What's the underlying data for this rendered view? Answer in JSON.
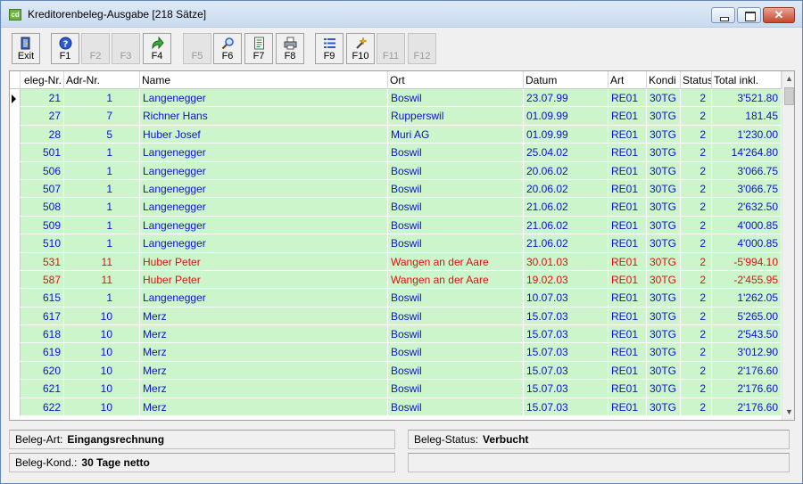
{
  "window": {
    "icon_text": "cd",
    "title": "Kreditorenbeleg-Ausgabe [218 Sätze]"
  },
  "toolbar": [
    {
      "label": "Exit",
      "icon": "exit-door-icon",
      "enabled": true
    },
    {
      "label": "F1",
      "icon": "help-icon",
      "enabled": true
    },
    {
      "label": "F2",
      "icon": "",
      "enabled": false
    },
    {
      "label": "F3",
      "icon": "",
      "enabled": false
    },
    {
      "label": "F4",
      "icon": "back-arrow-icon",
      "enabled": true
    },
    {
      "label": "F5",
      "icon": "",
      "enabled": false
    },
    {
      "label": "F6",
      "icon": "search-icon",
      "enabled": true
    },
    {
      "label": "F7",
      "icon": "document-icon",
      "enabled": true
    },
    {
      "label": "F8",
      "icon": "printer-icon",
      "enabled": true
    },
    {
      "label": "F9",
      "icon": "list-icon",
      "enabled": true
    },
    {
      "label": "F10",
      "icon": "wand-icon",
      "enabled": true
    },
    {
      "label": "F11",
      "icon": "",
      "enabled": false
    },
    {
      "label": "F12",
      "icon": "",
      "enabled": false
    }
  ],
  "table": {
    "columns": [
      "eleg-Nr.",
      "Adr-Nr.",
      "Name",
      "Ort",
      "Datum",
      "Art",
      "Kondi",
      "Status",
      "Total inkl."
    ],
    "rows": [
      {
        "beleg": "21",
        "adr": "1",
        "name": "Langenegger",
        "ort": "Boswil",
        "datum": "23.07.99",
        "art": "RE01",
        "kond": "30TG",
        "status": "2",
        "total": "3'521.80",
        "neg": false
      },
      {
        "beleg": "27",
        "adr": "7",
        "name": "Richner Hans",
        "ort": "Rupperswil",
        "datum": "01.09.99",
        "art": "RE01",
        "kond": "30TG",
        "status": "2",
        "total": "181.45",
        "neg": false
      },
      {
        "beleg": "28",
        "adr": "5",
        "name": "Huber Josef",
        "ort": "Muri AG",
        "datum": "01.09.99",
        "art": "RE01",
        "kond": "30TG",
        "status": "2",
        "total": "1'230.00",
        "neg": false
      },
      {
        "beleg": "501",
        "adr": "1",
        "name": "Langenegger",
        "ort": "Boswil",
        "datum": "25.04.02",
        "art": "RE01",
        "kond": "30TG",
        "status": "2",
        "total": "14'264.80",
        "neg": false
      },
      {
        "beleg": "506",
        "adr": "1",
        "name": "Langenegger",
        "ort": "Boswil",
        "datum": "20.06.02",
        "art": "RE01",
        "kond": "30TG",
        "status": "2",
        "total": "3'066.75",
        "neg": false
      },
      {
        "beleg": "507",
        "adr": "1",
        "name": "Langenegger",
        "ort": "Boswil",
        "datum": "20.06.02",
        "art": "RE01",
        "kond": "30TG",
        "status": "2",
        "total": "3'066.75",
        "neg": false
      },
      {
        "beleg": "508",
        "adr": "1",
        "name": "Langenegger",
        "ort": "Boswil",
        "datum": "21.06.02",
        "art": "RE01",
        "kond": "30TG",
        "status": "2",
        "total": "2'632.50",
        "neg": false
      },
      {
        "beleg": "509",
        "adr": "1",
        "name": "Langenegger",
        "ort": "Boswil",
        "datum": "21.06.02",
        "art": "RE01",
        "kond": "30TG",
        "status": "2",
        "total": "4'000.85",
        "neg": false
      },
      {
        "beleg": "510",
        "adr": "1",
        "name": "Langenegger",
        "ort": "Boswil",
        "datum": "21.06.02",
        "art": "RE01",
        "kond": "30TG",
        "status": "2",
        "total": "4'000.85",
        "neg": false
      },
      {
        "beleg": "531",
        "adr": "11",
        "name": "Huber Peter",
        "ort": "Wangen an der Aare",
        "datum": "30.01.03",
        "art": "RE01",
        "kond": "30TG",
        "status": "2",
        "total": "-5'994.10",
        "neg": true
      },
      {
        "beleg": "587",
        "adr": "11",
        "name": "Huber Peter",
        "ort": "Wangen an der Aare",
        "datum": "19.02.03",
        "art": "RE01",
        "kond": "30TG",
        "status": "2",
        "total": "-2'455.95",
        "neg": true
      },
      {
        "beleg": "615",
        "adr": "1",
        "name": "Langenegger",
        "ort": "Boswil",
        "datum": "10.07.03",
        "art": "RE01",
        "kond": "30TG",
        "status": "2",
        "total": "1'262.05",
        "neg": false
      },
      {
        "beleg": "617",
        "adr": "10",
        "name": "Merz",
        "ort": "Boswil",
        "datum": "15.07.03",
        "art": "RE01",
        "kond": "30TG",
        "status": "2",
        "total": "5'265.00",
        "neg": false
      },
      {
        "beleg": "618",
        "adr": "10",
        "name": "Merz",
        "ort": "Boswil",
        "datum": "15.07.03",
        "art": "RE01",
        "kond": "30TG",
        "status": "2",
        "total": "2'543.50",
        "neg": false
      },
      {
        "beleg": "619",
        "adr": "10",
        "name": "Merz",
        "ort": "Boswil",
        "datum": "15.07.03",
        "art": "RE01",
        "kond": "30TG",
        "status": "2",
        "total": "3'012.90",
        "neg": false
      },
      {
        "beleg": "620",
        "adr": "10",
        "name": "Merz",
        "ort": "Boswil",
        "datum": "15.07.03",
        "art": "RE01",
        "kond": "30TG",
        "status": "2",
        "total": "2'176.60",
        "neg": false
      },
      {
        "beleg": "621",
        "adr": "10",
        "name": "Merz",
        "ort": "Boswil",
        "datum": "15.07.03",
        "art": "RE01",
        "kond": "30TG",
        "status": "2",
        "total": "2'176.60",
        "neg": false
      },
      {
        "beleg": "622",
        "adr": "10",
        "name": "Merz",
        "ort": "Boswil",
        "datum": "15.07.03",
        "art": "RE01",
        "kond": "30TG",
        "status": "2",
        "total": "2'176.60",
        "neg": false
      }
    ]
  },
  "status": {
    "beleg_art_label": "Beleg-Art:",
    "beleg_art_value": "Eingangsrechnung",
    "beleg_status_label": "Beleg-Status:",
    "beleg_status_value": "Verbucht",
    "beleg_kond_label": "Beleg-Kond.:",
    "beleg_kond_value": "30 Tage netto"
  },
  "colors": {
    "row_bg": "#ccf5cc",
    "text_normal": "#1010d0",
    "text_negative": "#e01010"
  }
}
